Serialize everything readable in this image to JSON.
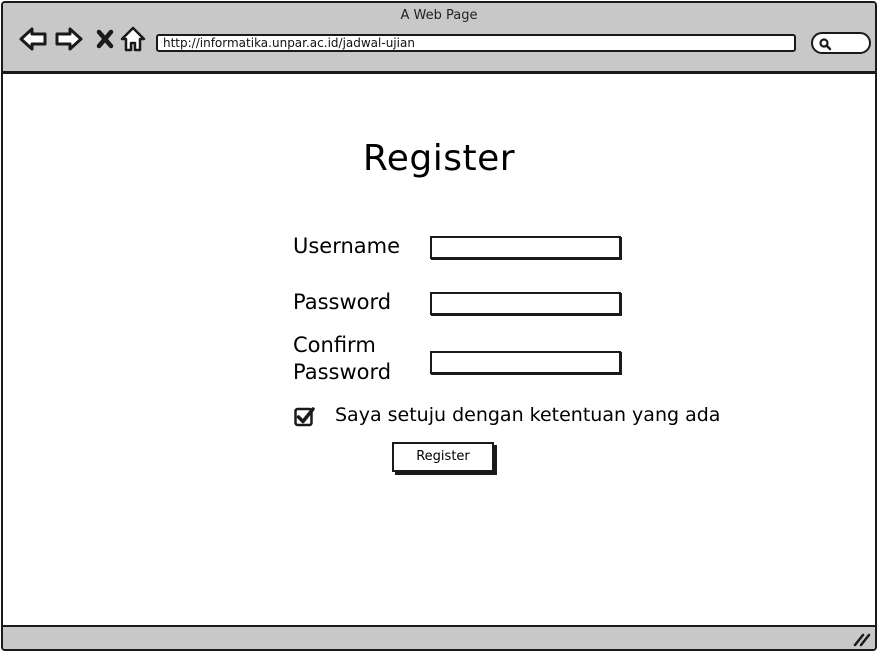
{
  "window": {
    "title": "A Web Page"
  },
  "browser": {
    "url": "http://informatika.unpar.ac.id/jadwal-ujian",
    "icons": {
      "back": "back-arrow-icon",
      "forward": "forward-arrow-icon",
      "stop": "close-icon",
      "home": "home-icon",
      "search": "search-icon",
      "resize": "resize-grip-icon"
    }
  },
  "form": {
    "title": "Register",
    "username_label": "Username",
    "password_label": "Password",
    "confirm_label_line1": "Confirm",
    "confirm_label_line2": "Password",
    "username_value": "",
    "password_value": "",
    "confirm_value": "",
    "agree_checked": true,
    "agree_label": "Saya setuju dengan ketentuan yang ada",
    "submit_label": "Register"
  }
}
